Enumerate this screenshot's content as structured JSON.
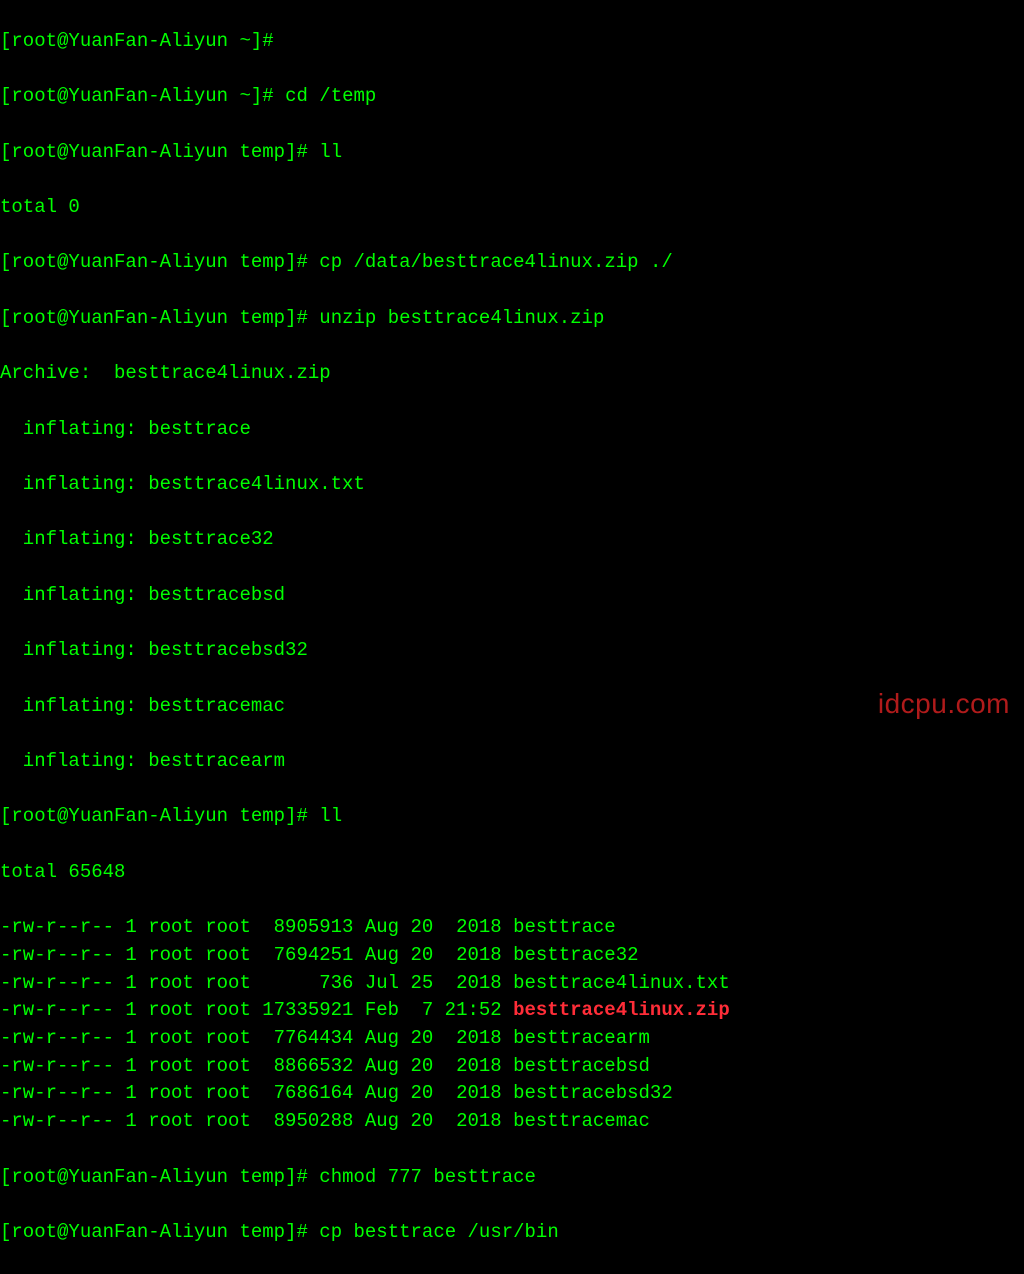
{
  "prompt": {
    "user": "root",
    "host": "YuanFan-Aliyun",
    "home_path": "~",
    "temp_path": "temp"
  },
  "commands": {
    "cd": "cd /temp",
    "ll1": "ll",
    "cp": "cp /data/besttrace4linux.zip ./",
    "unzip": "unzip besttrace4linux.zip",
    "ll2": "ll",
    "chmod": "chmod 777 besttrace",
    "cpbin": "cp besttrace /usr/bin"
  },
  "output": {
    "total0": "total 0",
    "archive": "Archive:  besttrace4linux.zip",
    "inflating": [
      "  inflating: besttrace",
      "  inflating: besttrace4linux.txt",
      "  inflating: besttrace32",
      "  inflating: besttracebsd",
      "  inflating: besttracebsd32",
      "  inflating: besttracemac",
      "  inflating: besttracearm"
    ],
    "total2": "total 65648"
  },
  "files": [
    {
      "perm": "-rw-r--r--",
      "links": "1",
      "owner": "root",
      "group": "root",
      "size": "8905913",
      "date": "Aug 20  2018",
      "name": "besttrace",
      "zip": false
    },
    {
      "perm": "-rw-r--r--",
      "links": "1",
      "owner": "root",
      "group": "root",
      "size": "7694251",
      "date": "Aug 20  2018",
      "name": "besttrace32",
      "zip": false
    },
    {
      "perm": "-rw-r--r--",
      "links": "1",
      "owner": "root",
      "group": "root",
      "size": "736",
      "date": "Jul 25  2018",
      "name": "besttrace4linux.txt",
      "zip": false
    },
    {
      "perm": "-rw-r--r--",
      "links": "1",
      "owner": "root",
      "group": "root",
      "size": "17335921",
      "date": "Feb  7 21:52",
      "name": "besttrace4linux.zip",
      "zip": true
    },
    {
      "perm": "-rw-r--r--",
      "links": "1",
      "owner": "root",
      "group": "root",
      "size": "7764434",
      "date": "Aug 20  2018",
      "name": "besttracearm",
      "zip": false
    },
    {
      "perm": "-rw-r--r--",
      "links": "1",
      "owner": "root",
      "group": "root",
      "size": "8866532",
      "date": "Aug 20  2018",
      "name": "besttracebsd",
      "zip": false
    },
    {
      "perm": "-rw-r--r--",
      "links": "1",
      "owner": "root",
      "group": "root",
      "size": "7686164",
      "date": "Aug 20  2018",
      "name": "besttracebsd32",
      "zip": false
    },
    {
      "perm": "-rw-r--r--",
      "links": "1",
      "owner": "root",
      "group": "root",
      "size": "8950288",
      "date": "Aug 20  2018",
      "name": "besttracemac",
      "zip": false
    }
  ],
  "watermark": "idcpu.com",
  "truncated_top": "[root@YuanFan-Aliyun ~]#",
  "truncated_bottom_prefix": "[root@YuanFan-Aliyun temp]#"
}
